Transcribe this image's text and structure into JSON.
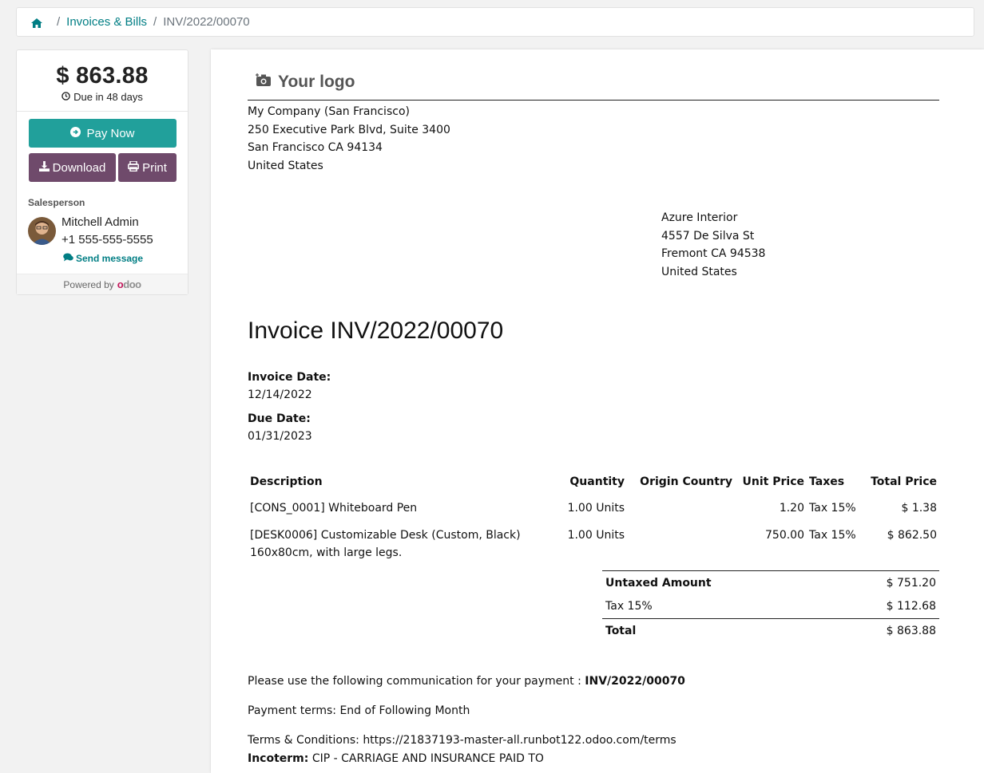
{
  "breadcrumb": {
    "home_icon": "home-icon",
    "section": "Invoices & Bills",
    "current": "INV/2022/00070"
  },
  "sidebar": {
    "amount": "$ 863.88",
    "due_text": "Due in 48 days",
    "pay_now": "Pay Now",
    "download": "Download",
    "print": "Print",
    "salesperson_label": "Salesperson",
    "salesperson_name": "Mitchell Admin",
    "salesperson_phone": "+1 555-555-5555",
    "send_message": "Send message",
    "powered_by": "Powered by",
    "powered_brand": "odoo",
    "colors": {
      "pay": "#21a09b",
      "secondary": "#6f4a6b",
      "link": "#017e84"
    }
  },
  "invoice": {
    "logo_text": "Your logo",
    "company": {
      "name": "My Company (San Francisco)",
      "street": "250 Executive Park Blvd, Suite 3400",
      "city": "San Francisco CA 94134",
      "country": "United States"
    },
    "partner": {
      "name": "Azure Interior",
      "street": "4557 De Silva St",
      "city": "Fremont CA 94538",
      "country": "United States"
    },
    "title": "Invoice INV/2022/00070",
    "invoice_date_label": "Invoice Date:",
    "invoice_date": "12/14/2022",
    "due_date_label": "Due Date:",
    "due_date": "01/31/2023",
    "columns": {
      "description": "Description",
      "quantity": "Quantity",
      "origin": "Origin Country",
      "unit_price": "Unit Price",
      "taxes": "Taxes",
      "total": "Total Price"
    },
    "lines": [
      {
        "description": "[CONS_0001] Whiteboard Pen",
        "description2": "",
        "quantity": "1.00 Units",
        "origin": "",
        "unit_price": "1.20",
        "taxes": "Tax 15%",
        "total": "$ 1.38"
      },
      {
        "description": "[DESK0006] Customizable Desk (Custom, Black)",
        "description2": "160x80cm, with large legs.",
        "quantity": "1.00 Units",
        "origin": "",
        "unit_price": "750.00",
        "taxes": "Tax 15%",
        "total": "$ 862.50"
      }
    ],
    "totals": {
      "untaxed_label": "Untaxed Amount",
      "untaxed": "$ 751.20",
      "tax_label": "Tax 15%",
      "tax": "$ 112.68",
      "total_label": "Total",
      "total": "$ 863.88"
    },
    "payment_comm_text": "Please use the following communication for your payment :",
    "payment_comm_ref": "INV/2022/00070",
    "payment_terms": "Payment terms: End of Following Month",
    "terms": "Terms & Conditions: https://21837193-master-all.runbot122.odoo.com/terms",
    "incoterm_label": "Incoterm:",
    "incoterm": "CIP - CARRIAGE AND INSURANCE PAID TO"
  }
}
